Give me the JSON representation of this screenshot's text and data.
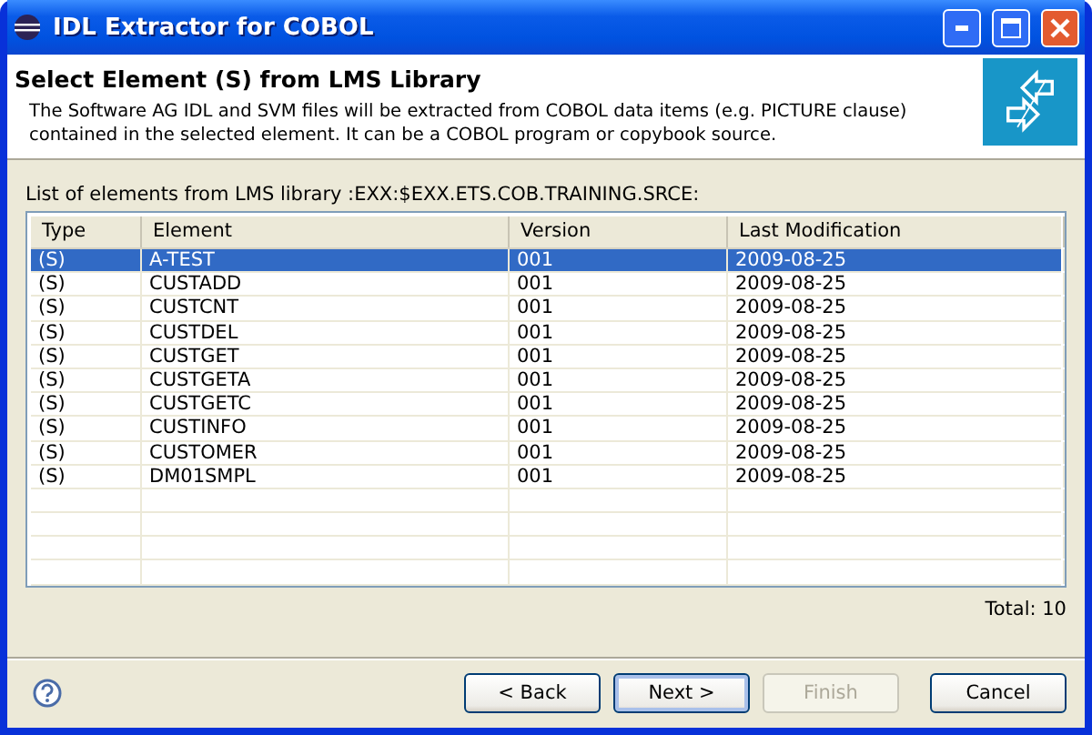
{
  "window": {
    "title": "IDL Extractor for COBOL"
  },
  "header": {
    "title": "Select Element (S) from LMS Library",
    "description": "The Software AG IDL and SVM files will be extracted from COBOL data items (e.g. PICTURE clause) contained in the selected element. It can be a COBOL program or copybook source."
  },
  "list_label": "List of elements from LMS library :EXX:$EXX.ETS.COB.TRAINING.SRCE:",
  "table": {
    "columns": [
      "Type",
      "Element",
      "Version",
      "Last Modification"
    ],
    "rows": [
      {
        "cells": [
          "(S)",
          "A-TEST",
          "001",
          "2009-08-25"
        ],
        "selected": true
      },
      {
        "cells": [
          "(S)",
          "CUSTADD",
          "001",
          "2009-08-25"
        ],
        "selected": false
      },
      {
        "cells": [
          "(S)",
          "CUSTCNT",
          "001",
          "2009-08-25"
        ],
        "selected": false
      },
      {
        "cells": [
          "(S)",
          "CUSTDEL",
          "001",
          "2009-08-25"
        ],
        "selected": false
      },
      {
        "cells": [
          "(S)",
          "CUSTGET",
          "001",
          "2009-08-25"
        ],
        "selected": false
      },
      {
        "cells": [
          "(S)",
          "CUSTGETA",
          "001",
          "2009-08-25"
        ],
        "selected": false
      },
      {
        "cells": [
          "(S)",
          "CUSTGETC",
          "001",
          "2009-08-25"
        ],
        "selected": false
      },
      {
        "cells": [
          "(S)",
          "CUSTINFO",
          "001",
          "2009-08-25"
        ],
        "selected": false
      },
      {
        "cells": [
          "(S)",
          "CUSTOMER",
          "001",
          "2009-08-25"
        ],
        "selected": false
      },
      {
        "cells": [
          "(S)",
          "DM01SMPL",
          "001",
          "2009-08-25"
        ],
        "selected": false
      }
    ]
  },
  "total": "Total: 10",
  "buttons": [
    {
      "label": "< Back",
      "disabled": false,
      "default": false
    },
    {
      "label": "Next >",
      "disabled": false,
      "default": true
    },
    {
      "label": "Finish",
      "disabled": true,
      "default": false
    },
    {
      "label": "Cancel",
      "disabled": false,
      "default": false
    }
  ]
}
